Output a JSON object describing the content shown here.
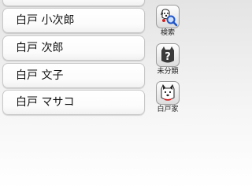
{
  "contacts": [
    {
      "name": ""
    },
    {
      "name": "白戸 小次郎"
    },
    {
      "name": "白戸 次郎"
    },
    {
      "name": "白戸 文子"
    },
    {
      "name": "白戸 マサコ"
    }
  ],
  "side_menu": {
    "search": {
      "label": "検索",
      "icon": "dog-magnifier-icon"
    },
    "uncategorized": {
      "label": "未分類",
      "icon": "question-mark-icon"
    },
    "shirato_family": {
      "label": "白戸家",
      "icon": "white-dog-icon"
    }
  },
  "colors": {
    "row_border": "#c9c9c9",
    "text": "#111111",
    "icon_dark": "#3a3a3a",
    "accent_red": "#d32020",
    "accent_blue": "#1e55c8"
  }
}
